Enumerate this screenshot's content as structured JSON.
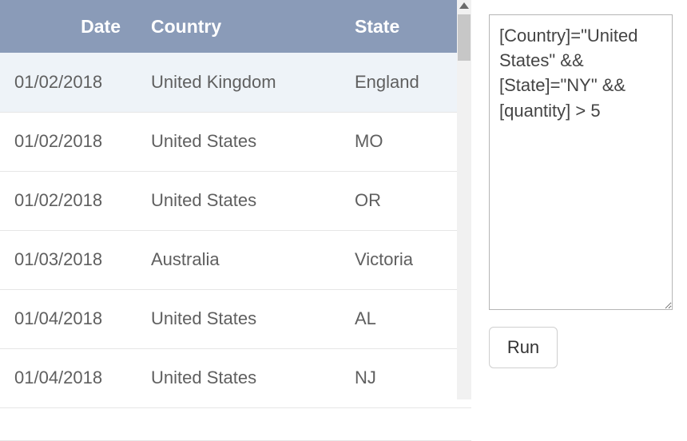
{
  "table": {
    "headers": {
      "date": "Date",
      "country": "Country",
      "state": "State"
    },
    "rows": [
      {
        "date": "01/02/2018",
        "country": "United Kingdom",
        "state": "England"
      },
      {
        "date": "01/02/2018",
        "country": "United States",
        "state": "MO"
      },
      {
        "date": "01/02/2018",
        "country": "United States",
        "state": "OR"
      },
      {
        "date": "01/03/2018",
        "country": "Australia",
        "state": "Victoria"
      },
      {
        "date": "01/04/2018",
        "country": "United States",
        "state": "AL"
      },
      {
        "date": "01/04/2018",
        "country": "United States",
        "state": "NJ"
      }
    ]
  },
  "query": {
    "text": "[Country]=\"United States\" && [State]=\"NY\" && [quantity] > 5"
  },
  "buttons": {
    "run": "Run"
  }
}
